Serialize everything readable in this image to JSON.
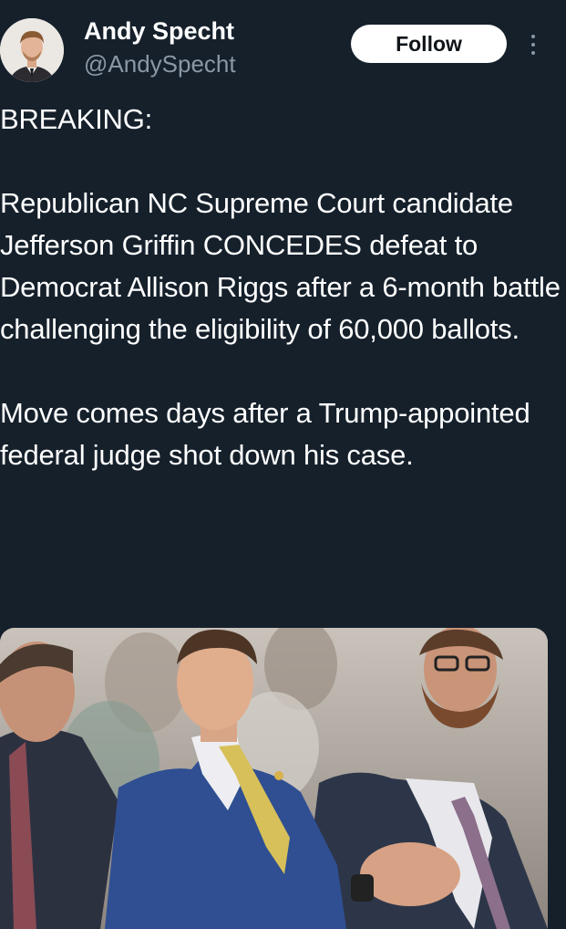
{
  "author": {
    "display_name": "Andy Specht",
    "handle": "@AndySpecht",
    "avatar_icon": "person-portrait-icon"
  },
  "actions": {
    "follow_label": "Follow",
    "more_icon": "vertical-ellipsis-icon"
  },
  "tweet": {
    "paragraphs": [
      "BREAKING:",
      "Republican NC Supreme Court candidate Jefferson Griffin CONCEDES defeat to Democrat Allison Riggs after a 6-month battle challenging the eligibility of 60,000 ballots.",
      "Move comes days after a Trump-appointed federal judge shot down his case."
    ]
  },
  "media": {
    "type": "photo"
  },
  "colors": {
    "background": "#15202b",
    "text": "#ffffff",
    "secondary_text": "#8b98a5",
    "follow_button_bg": "#ffffff",
    "follow_button_text": "#0f1419"
  }
}
